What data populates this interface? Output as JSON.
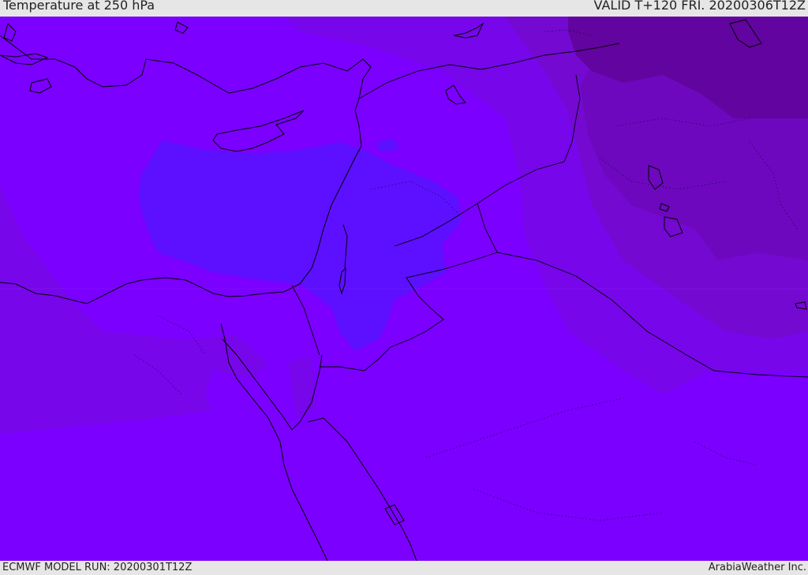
{
  "header": {
    "title": "Temperature at 250 hPa",
    "valid": "VALID T+120 FRI. 20200306T12Z"
  },
  "footer": {
    "model_run": "ECMWF MODEL RUN: 20200301T12Z",
    "credit": "ArabiaWeather Inc."
  },
  "colors": {
    "base": "#7b00ff",
    "cool_blue": "#5c10ff",
    "warm_1": "#7706ea",
    "warm_2": "#7409d2",
    "warm_3": "#6d08bf",
    "warm_4": "#62049f",
    "coast": "#000000"
  }
}
